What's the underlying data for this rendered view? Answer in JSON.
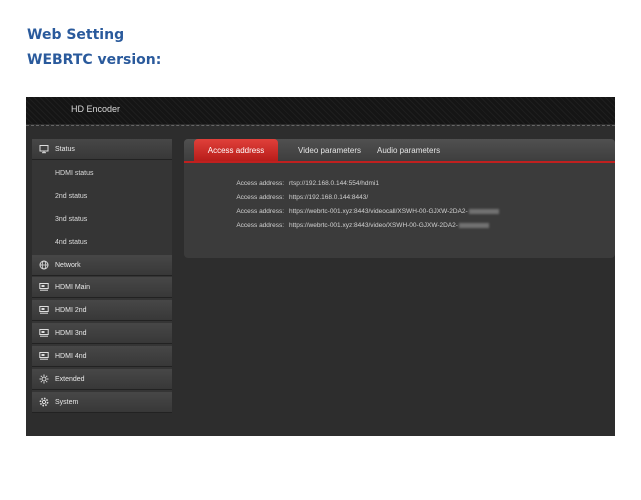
{
  "document": {
    "heading1": "Web  Setting",
    "heading2": "WEBRTC version:"
  },
  "app": {
    "title": "HD Encoder"
  },
  "sidebar": {
    "items": [
      {
        "label": "Status",
        "icon": "monitor-icon"
      },
      {
        "label": "HDMI status"
      },
      {
        "label": "2nd status"
      },
      {
        "label": "3nd status"
      },
      {
        "label": "4nd status"
      },
      {
        "label": "Network",
        "icon": "globe-icon"
      },
      {
        "label": "HDMI Main",
        "icon": "video-card-icon"
      },
      {
        "label": "HDMI 2nd",
        "icon": "video-card-icon"
      },
      {
        "label": "HDMI 3nd",
        "icon": "video-card-icon"
      },
      {
        "label": "HDMI 4nd",
        "icon": "video-card-icon"
      },
      {
        "label": "Extended",
        "icon": "extend-gear-icon"
      },
      {
        "label": "System",
        "icon": "gear-icon"
      }
    ]
  },
  "tabs": [
    {
      "label": "Access address",
      "active": true
    },
    {
      "label": "Video parameters",
      "active": false
    },
    {
      "label": "Audio parameters",
      "active": false
    }
  ],
  "access": {
    "rows": [
      {
        "label": "Access address:",
        "value": "rtsp://192.168.0.144:554/hdmi1"
      },
      {
        "label": "Access address:",
        "value": "https://192.168.0.144:8443/"
      },
      {
        "label": "Access address:",
        "value": "https://webrtc-001.xyz:8443/videocall/XSWH-00-GJXW-2DA2-"
      },
      {
        "label": "Access address:",
        "value": "https://webrtc-001.xyz:8443/video/XSWH-00-GJXW-2DA2-"
      }
    ]
  },
  "colors": {
    "heading": "#2a5a9c",
    "accent": "#c0201f",
    "background": "#2d2d2d"
  }
}
